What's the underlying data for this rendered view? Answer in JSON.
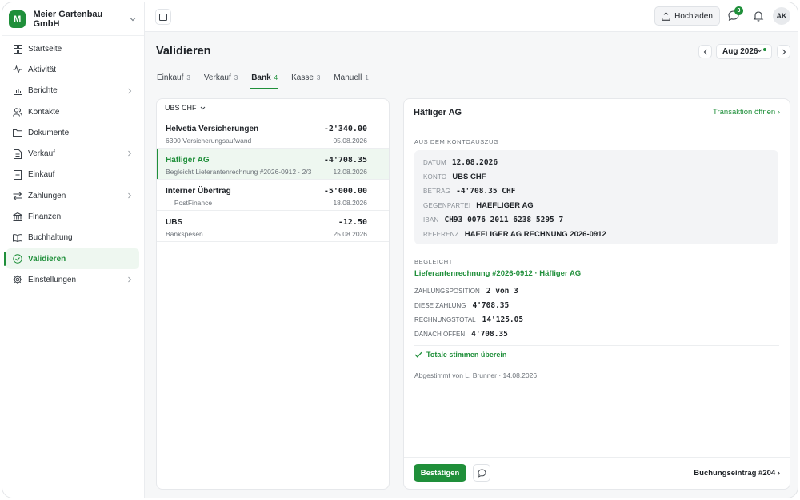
{
  "company": {
    "logo_letter": "M",
    "name": "Meier Gartenbau GmbH"
  },
  "sidebar": {
    "items": [
      {
        "label": "Startseite",
        "icon": "grid-icon"
      },
      {
        "label": "Aktivität",
        "icon": "activity-icon"
      },
      {
        "label": "Berichte",
        "icon": "bar-chart-icon"
      },
      {
        "label": "Kontakte",
        "icon": "users-icon"
      },
      {
        "label": "Dokumente",
        "icon": "folder-icon"
      },
      {
        "label": "Verkauf",
        "icon": "file-icon"
      },
      {
        "label": "Einkauf",
        "icon": "receipt-icon"
      },
      {
        "label": "Zahlungen",
        "icon": "transfer-icon"
      },
      {
        "label": "Finanzen",
        "icon": "bank-icon"
      },
      {
        "label": "Buchhaltung",
        "icon": "book-icon"
      },
      {
        "label": "Validieren",
        "icon": "check-circle-icon"
      },
      {
        "label": "Einstellungen",
        "icon": "gear-icon"
      }
    ]
  },
  "topbar": {
    "upload_label": "Hochladen",
    "chat_badge": "3",
    "avatar_initials": "AK"
  },
  "page": {
    "title": "Validieren",
    "period": "Aug 2026"
  },
  "tabs": [
    {
      "label": "Einkauf",
      "count": "3"
    },
    {
      "label": "Verkauf",
      "count": "3"
    },
    {
      "label": "Bank",
      "count": "4"
    },
    {
      "label": "Kasse",
      "count": "3"
    },
    {
      "label": "Manuell",
      "count": "1"
    }
  ],
  "list": {
    "account": "UBS CHF",
    "transactions": [
      {
        "name": "Helvetia Versicherungen",
        "sub": "6300 Versicherungsaufwand",
        "amount": "-2'340.00",
        "date": "05.08.2026"
      },
      {
        "name": "Häfliger AG",
        "sub": "Begleicht Lieferantenrechnung #2026-0912 · 2/3",
        "amount": "-4'708.35",
        "date": "12.08.2026"
      },
      {
        "name": "Interner Übertrag",
        "sub": "→ PostFinance",
        "amount": "-5'000.00",
        "date": "18.08.2026"
      },
      {
        "name": "UBS",
        "sub": "Bankspesen",
        "amount": "-12.50",
        "date": "25.08.2026"
      }
    ]
  },
  "detail": {
    "title": "Häfliger AG",
    "open_link": "Transaktion öffnen ›",
    "statement_label": "AUS DEM KONTOAUSZUG",
    "statement": [
      {
        "key": "DATUM",
        "value": "12.08.2026"
      },
      {
        "key": "KONTO",
        "value": "UBS CHF"
      },
      {
        "key": "BETRAG",
        "value": "-4'708.35 CHF"
      },
      {
        "key": "GEGENPARTEI",
        "value": "HAEFLIGER AG"
      },
      {
        "key": "IBAN",
        "value": "CH93 0076 2011 6238 5295 7"
      },
      {
        "key": "REFERENZ",
        "value": "HAEFLIGER AG RECHNUNG 2026-0912"
      }
    ],
    "settled_label": "BEGLEICHT",
    "invoice_link": "Lieferantenrechnung #2026-0912 · Häfliger AG",
    "payment": [
      {
        "key": "ZAHLUNGSPOSITION",
        "value": "2 von 3"
      },
      {
        "key": "DIESE ZAHLUNG",
        "value": "4'708.35"
      },
      {
        "key": "RECHNUNGSTOTAL",
        "value": "14'125.05"
      },
      {
        "key": "DANACH OFFEN",
        "value": "4'708.35"
      }
    ],
    "match_text": "Totale stimmen überein",
    "approved_text": "Abgestimmt von L. Brunner · 14.08.2026",
    "confirm_label": "Bestätigen",
    "journal_link": "Buchungseintrag #204 ›"
  },
  "colors": {
    "accent": "#1f8f3a",
    "accent_bg": "#eef7f0"
  }
}
